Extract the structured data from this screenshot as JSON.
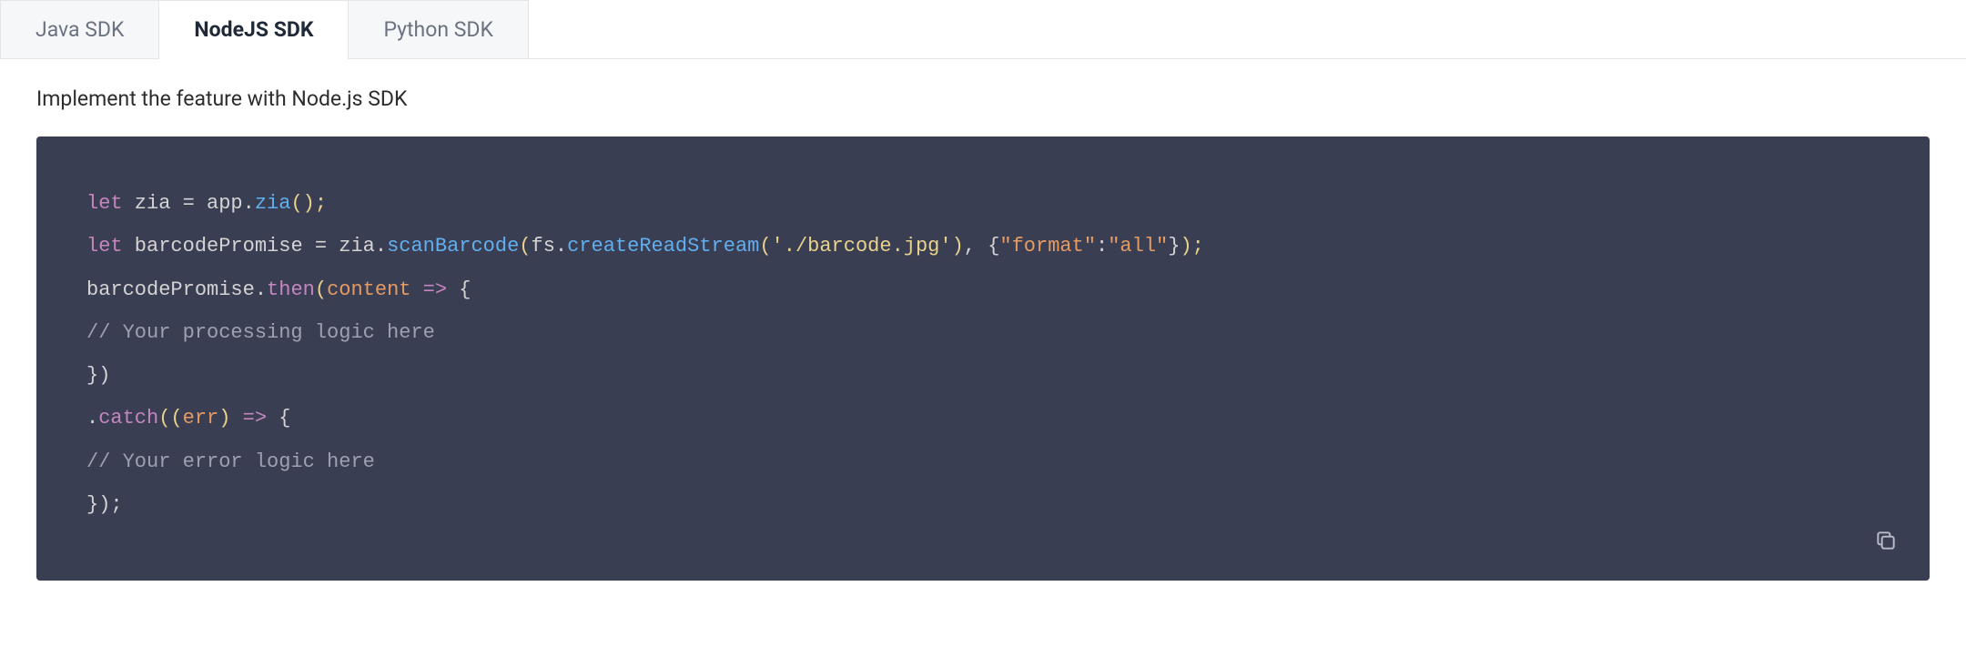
{
  "tabs": [
    {
      "label": "Java SDK",
      "active": false
    },
    {
      "label": "NodeJS SDK",
      "active": true
    },
    {
      "label": "Python SDK",
      "active": false
    }
  ],
  "description": "Implement the feature with Node.js SDK",
  "code": {
    "line1": {
      "let": "let",
      "var": " zia ",
      "eq": "= ",
      "obj": "app",
      "dot": ".",
      "method": "zia",
      "paren": "();"
    },
    "line2": {
      "let": "let",
      "var": " barcodePromise ",
      "eq": "= ",
      "obj": "zia",
      "dot": ".",
      "method": "scanBarcode",
      "open": "(",
      "fs": "fs",
      "dot2": ".",
      "create": "createReadStream",
      "open2": "(",
      "str": "'./barcode.jpg'",
      "close2": ")",
      "comma": ", ",
      "objopen": "{",
      "key": "\"format\"",
      "colon": ":",
      "val": "\"all\"",
      "objclose": "}",
      "close": ");"
    },
    "line3": {
      "obj": "barcodePromise",
      "dot": ".",
      "then": "then",
      "open": "(",
      "param": "content",
      "arrow": " => ",
      "brace": "{"
    },
    "line4": {
      "comment": "// Your processing logic here"
    },
    "line5": {
      "close": "})"
    },
    "line6": {
      "dot": ".",
      "catch": "catch",
      "open": "((",
      "param": "err",
      "close": ")",
      "arrow": " => ",
      "brace": "{"
    },
    "line7": {
      "comment": "// Your error logic here"
    },
    "line8": {
      "close": "});"
    }
  },
  "copy_label": "Copy"
}
